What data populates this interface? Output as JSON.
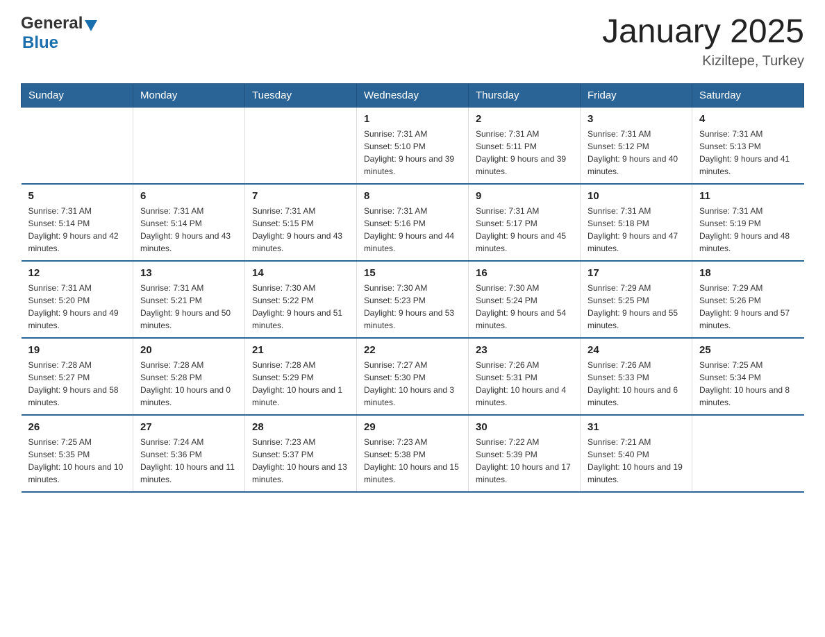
{
  "header": {
    "logo_general": "General",
    "logo_blue": "Blue",
    "month_title": "January 2025",
    "location": "Kiziltepe, Turkey"
  },
  "days_of_week": [
    "Sunday",
    "Monday",
    "Tuesday",
    "Wednesday",
    "Thursday",
    "Friday",
    "Saturday"
  ],
  "weeks": [
    [
      {
        "day": "",
        "sunrise": "",
        "sunset": "",
        "daylight": ""
      },
      {
        "day": "",
        "sunrise": "",
        "sunset": "",
        "daylight": ""
      },
      {
        "day": "",
        "sunrise": "",
        "sunset": "",
        "daylight": ""
      },
      {
        "day": "1",
        "sunrise": "Sunrise: 7:31 AM",
        "sunset": "Sunset: 5:10 PM",
        "daylight": "Daylight: 9 hours and 39 minutes."
      },
      {
        "day": "2",
        "sunrise": "Sunrise: 7:31 AM",
        "sunset": "Sunset: 5:11 PM",
        "daylight": "Daylight: 9 hours and 39 minutes."
      },
      {
        "day": "3",
        "sunrise": "Sunrise: 7:31 AM",
        "sunset": "Sunset: 5:12 PM",
        "daylight": "Daylight: 9 hours and 40 minutes."
      },
      {
        "day": "4",
        "sunrise": "Sunrise: 7:31 AM",
        "sunset": "Sunset: 5:13 PM",
        "daylight": "Daylight: 9 hours and 41 minutes."
      }
    ],
    [
      {
        "day": "5",
        "sunrise": "Sunrise: 7:31 AM",
        "sunset": "Sunset: 5:14 PM",
        "daylight": "Daylight: 9 hours and 42 minutes."
      },
      {
        "day": "6",
        "sunrise": "Sunrise: 7:31 AM",
        "sunset": "Sunset: 5:14 PM",
        "daylight": "Daylight: 9 hours and 43 minutes."
      },
      {
        "day": "7",
        "sunrise": "Sunrise: 7:31 AM",
        "sunset": "Sunset: 5:15 PM",
        "daylight": "Daylight: 9 hours and 43 minutes."
      },
      {
        "day": "8",
        "sunrise": "Sunrise: 7:31 AM",
        "sunset": "Sunset: 5:16 PM",
        "daylight": "Daylight: 9 hours and 44 minutes."
      },
      {
        "day": "9",
        "sunrise": "Sunrise: 7:31 AM",
        "sunset": "Sunset: 5:17 PM",
        "daylight": "Daylight: 9 hours and 45 minutes."
      },
      {
        "day": "10",
        "sunrise": "Sunrise: 7:31 AM",
        "sunset": "Sunset: 5:18 PM",
        "daylight": "Daylight: 9 hours and 47 minutes."
      },
      {
        "day": "11",
        "sunrise": "Sunrise: 7:31 AM",
        "sunset": "Sunset: 5:19 PM",
        "daylight": "Daylight: 9 hours and 48 minutes."
      }
    ],
    [
      {
        "day": "12",
        "sunrise": "Sunrise: 7:31 AM",
        "sunset": "Sunset: 5:20 PM",
        "daylight": "Daylight: 9 hours and 49 minutes."
      },
      {
        "day": "13",
        "sunrise": "Sunrise: 7:31 AM",
        "sunset": "Sunset: 5:21 PM",
        "daylight": "Daylight: 9 hours and 50 minutes."
      },
      {
        "day": "14",
        "sunrise": "Sunrise: 7:30 AM",
        "sunset": "Sunset: 5:22 PM",
        "daylight": "Daylight: 9 hours and 51 minutes."
      },
      {
        "day": "15",
        "sunrise": "Sunrise: 7:30 AM",
        "sunset": "Sunset: 5:23 PM",
        "daylight": "Daylight: 9 hours and 53 minutes."
      },
      {
        "day": "16",
        "sunrise": "Sunrise: 7:30 AM",
        "sunset": "Sunset: 5:24 PM",
        "daylight": "Daylight: 9 hours and 54 minutes."
      },
      {
        "day": "17",
        "sunrise": "Sunrise: 7:29 AM",
        "sunset": "Sunset: 5:25 PM",
        "daylight": "Daylight: 9 hours and 55 minutes."
      },
      {
        "day": "18",
        "sunrise": "Sunrise: 7:29 AM",
        "sunset": "Sunset: 5:26 PM",
        "daylight": "Daylight: 9 hours and 57 minutes."
      }
    ],
    [
      {
        "day": "19",
        "sunrise": "Sunrise: 7:28 AM",
        "sunset": "Sunset: 5:27 PM",
        "daylight": "Daylight: 9 hours and 58 minutes."
      },
      {
        "day": "20",
        "sunrise": "Sunrise: 7:28 AM",
        "sunset": "Sunset: 5:28 PM",
        "daylight": "Daylight: 10 hours and 0 minutes."
      },
      {
        "day": "21",
        "sunrise": "Sunrise: 7:28 AM",
        "sunset": "Sunset: 5:29 PM",
        "daylight": "Daylight: 10 hours and 1 minute."
      },
      {
        "day": "22",
        "sunrise": "Sunrise: 7:27 AM",
        "sunset": "Sunset: 5:30 PM",
        "daylight": "Daylight: 10 hours and 3 minutes."
      },
      {
        "day": "23",
        "sunrise": "Sunrise: 7:26 AM",
        "sunset": "Sunset: 5:31 PM",
        "daylight": "Daylight: 10 hours and 4 minutes."
      },
      {
        "day": "24",
        "sunrise": "Sunrise: 7:26 AM",
        "sunset": "Sunset: 5:33 PM",
        "daylight": "Daylight: 10 hours and 6 minutes."
      },
      {
        "day": "25",
        "sunrise": "Sunrise: 7:25 AM",
        "sunset": "Sunset: 5:34 PM",
        "daylight": "Daylight: 10 hours and 8 minutes."
      }
    ],
    [
      {
        "day": "26",
        "sunrise": "Sunrise: 7:25 AM",
        "sunset": "Sunset: 5:35 PM",
        "daylight": "Daylight: 10 hours and 10 minutes."
      },
      {
        "day": "27",
        "sunrise": "Sunrise: 7:24 AM",
        "sunset": "Sunset: 5:36 PM",
        "daylight": "Daylight: 10 hours and 11 minutes."
      },
      {
        "day": "28",
        "sunrise": "Sunrise: 7:23 AM",
        "sunset": "Sunset: 5:37 PM",
        "daylight": "Daylight: 10 hours and 13 minutes."
      },
      {
        "day": "29",
        "sunrise": "Sunrise: 7:23 AM",
        "sunset": "Sunset: 5:38 PM",
        "daylight": "Daylight: 10 hours and 15 minutes."
      },
      {
        "day": "30",
        "sunrise": "Sunrise: 7:22 AM",
        "sunset": "Sunset: 5:39 PM",
        "daylight": "Daylight: 10 hours and 17 minutes."
      },
      {
        "day": "31",
        "sunrise": "Sunrise: 7:21 AM",
        "sunset": "Sunset: 5:40 PM",
        "daylight": "Daylight: 10 hours and 19 minutes."
      },
      {
        "day": "",
        "sunrise": "",
        "sunset": "",
        "daylight": ""
      }
    ]
  ]
}
